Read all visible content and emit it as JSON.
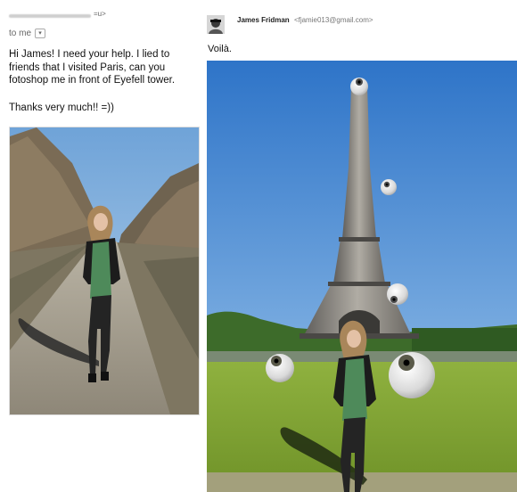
{
  "email": {
    "sender_suffix": "=u>",
    "recipient_label": "to me",
    "recipient_dropdown_glyph": "▾",
    "message_lines": [
      "Hi James! I need your help. I lied to",
      "friends that I visited Paris, can you",
      "fotoshop me in front of Eyefell tower."
    ],
    "thanks": "Thanks very much!! =))"
  },
  "reply": {
    "author_name": "James Fridman",
    "author_email": "<fjamie013@gmail.com>",
    "message": "Voilà."
  },
  "icons": {
    "avatar": "person-avatar-icon",
    "dropdown": "chevron-down-icon"
  }
}
